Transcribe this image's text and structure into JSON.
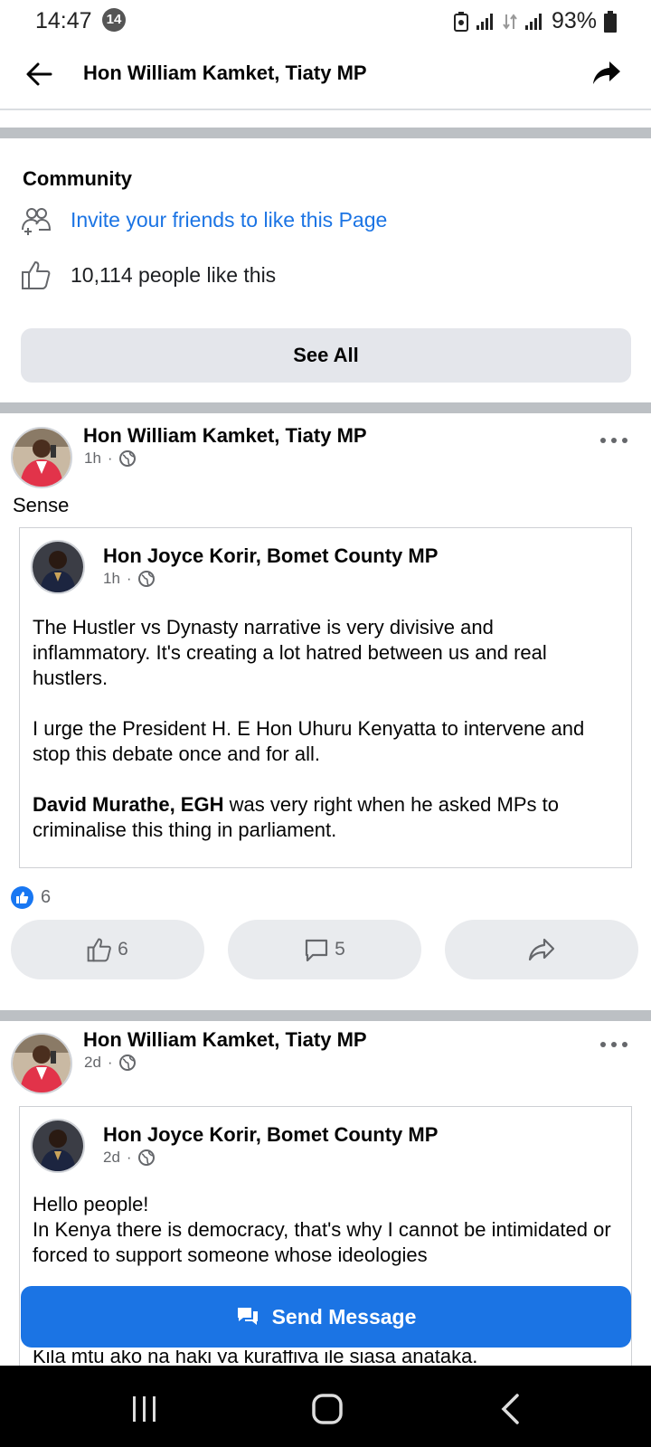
{
  "status_bar": {
    "time": "14:47",
    "notification_count": "14",
    "battery": "93%"
  },
  "header": {
    "title": "Hon William Kamket, Tiaty MP"
  },
  "community": {
    "title": "Community",
    "invite_text": "Invite your friends to like this Page",
    "likes_text": "10,114 people like this",
    "see_all": "See All"
  },
  "posts": [
    {
      "author": "Hon William Kamket, Tiaty MP",
      "time": "1h",
      "caption": "Sense",
      "shared": {
        "author": "Hon Joyce Korir, Bomet County MP",
        "time": "1h",
        "paragraphs": [
          "The Hustler vs Dynasty narrative is very divisive and inflammatory. It's creating a lot hatred between us and real hustlers.",
          "I urge the President H. E Hon Uhuru Kenyatta to intervene and stop this debate once and for all."
        ],
        "mention": "David Murathe, EGH",
        "mention_rest": " was very right when he asked MPs to criminalise this thing in parliament."
      },
      "reaction_count": "6",
      "like_count": "6",
      "comment_count": "5"
    },
    {
      "author": "Hon William Kamket, Tiaty MP",
      "time": "2d",
      "shared": {
        "author": "Hon Joyce Korir, Bomet County MP",
        "time": "2d",
        "line1": "Hello people!",
        "line2": "In Kenya there is democracy, that's why I cannot be intimidated or forced to support someone whose ideologies"
      },
      "cutoff_text": "Kila mtu ako na haki ya kuraffiya ile siasa anataka."
    }
  ],
  "send_message": "Send Message",
  "colors": {
    "accent": "#1b74e4",
    "button_gray": "#e4e6eb",
    "meta_gray": "#65676b"
  }
}
